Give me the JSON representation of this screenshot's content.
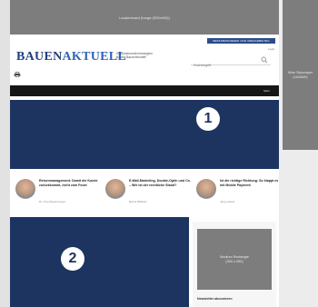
{
  "ads": {
    "leaderboard_label": "Leaderboard (tunga (925x400))",
    "skyscraper_label": "Wide Skyscraper (160x600)",
    "medium_rectangle_line1": "Medium Rectangle",
    "medium_rectangle_line2": "(300 x 250)",
    "slot1_number": "1",
    "slot2_number": "2"
  },
  "header": {
    "subscribe_button": "BESTABONNIEREN UND ÜBERARBEITEN",
    "logo_part1": "BAUEN",
    "logo_part2": "AKTUELL",
    "tagline_line1": "Informationstechnologien",
    "tagline_line2": "für die Bauwirtschaft",
    "login_link": "Login",
    "search_placeholder": "Suchbegriff",
    "nav_more": "Mehr"
  },
  "articles": [
    {
      "headline": "Reisenmanagement: Damit die Kunde zurückkommt, nicht zum Feuer",
      "author": "Dr. Jörg Westermayer"
    },
    {
      "headline": "E-Mail-Marketing, Double-Optin und Co. – Wie ist der rechtliche Stand?",
      "author": "Bernd Rühbelt"
    },
    {
      "headline": "Ist die richtige Richtung: So klappt es mit Mobile Payment",
      "author": "Jörg Lindner"
    }
  ],
  "sidebar": {
    "newsletter_label": "Newsletter abonnieren"
  },
  "colors": {
    "ad_slot": "#1d3461",
    "ad_placeholder": "#7d7d7d",
    "brand_dark": "#1f3f7a",
    "brand_light": "#2f63b5",
    "navbar": "#161616"
  }
}
